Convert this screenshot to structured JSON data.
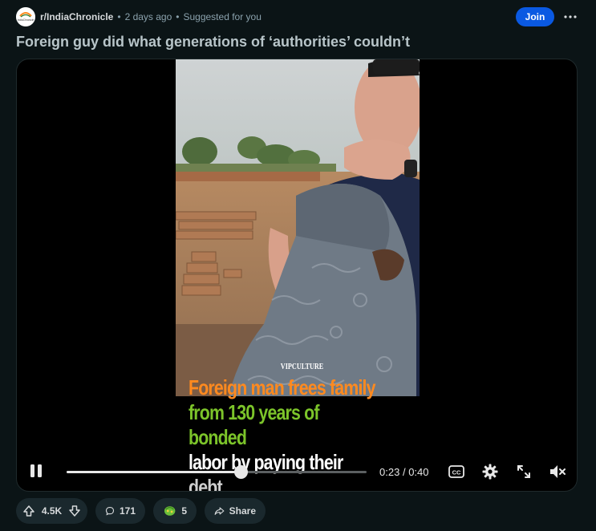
{
  "post": {
    "subreddit": "r/IndiaChronicle",
    "subreddit_avatar_text": "IndiaChronicle",
    "age": "2 days ago",
    "reason": "Suggested for you",
    "join_label": "Join",
    "more_label": "•••",
    "title": "Foreign guy did what generations of ‘authorities’ couldn’t"
  },
  "video": {
    "brand": "VIPCULTURE",
    "caption_lines": [
      "Foreign man frees family",
      "from 130 years of bonded",
      "labor by paying their",
      "debt..."
    ],
    "caption_colors": [
      "#ff8a1f",
      "#7cc42a",
      "#ffffff",
      "#cfcfcf"
    ],
    "progress_fraction": 0.58,
    "current_time": "0:23",
    "time_separator": "/",
    "duration": "0:40",
    "muted": true
  },
  "actions": {
    "upvotes": "4.5K",
    "comments": "171",
    "awards": "5",
    "share_label": "Share"
  },
  "colors": {
    "background": "#0b1416",
    "join_button": "#0a59e2",
    "pill": "#1a282d"
  },
  "icons": {
    "play_pause": "pause-icon",
    "captions": "closed-captions-icon",
    "settings": "gear-icon",
    "fullscreen": "expand-icon",
    "volume": "muted-speaker-icon",
    "upvote": "arrow-up-icon",
    "downvote": "arrow-down-icon",
    "comment": "speech-bubble-icon",
    "award": "award-icon",
    "share": "share-arrow-icon"
  }
}
